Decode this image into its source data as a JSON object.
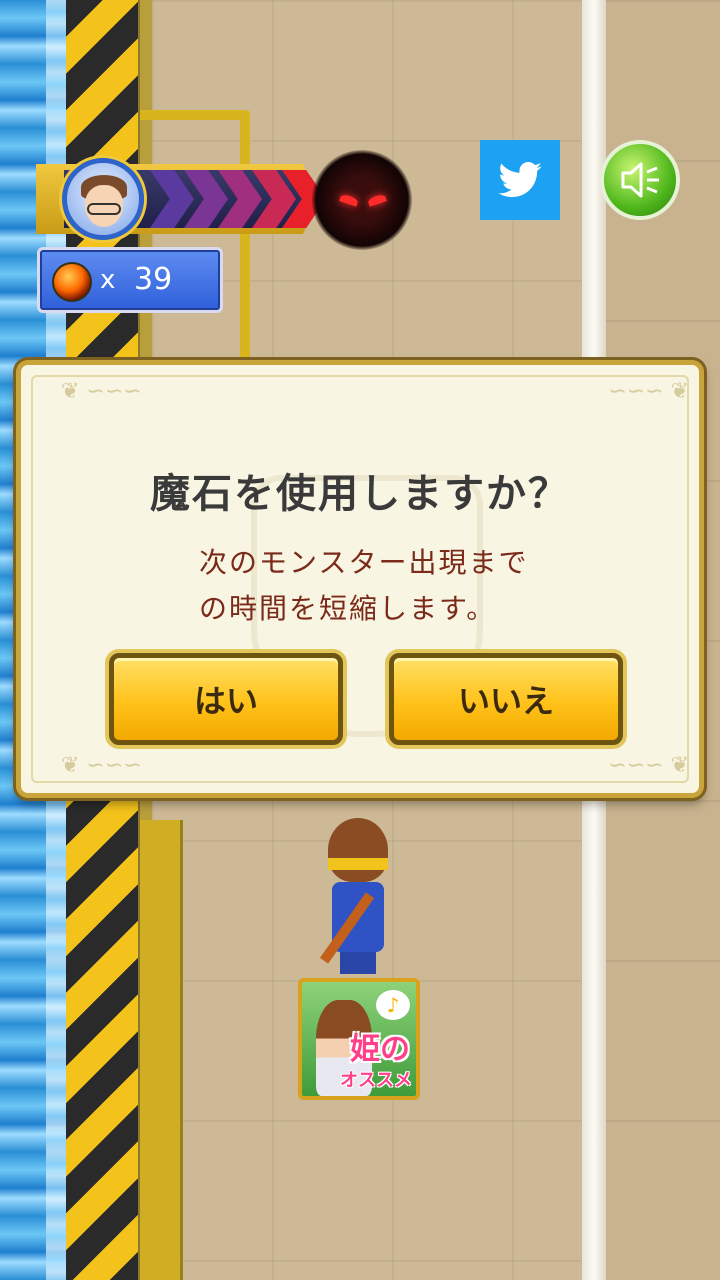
{
  "hud": {
    "gem_count_prefix": "x",
    "gem_count": "39",
    "progress_chevrons": 5
  },
  "icons": {
    "avatar": "player-avatar-icon",
    "monster": "dark-monster-icon",
    "gem": "magic-stone-icon",
    "twitter": "twitter-icon",
    "sound": "speaker-icon"
  },
  "dialog": {
    "title": "魔石を使用しますか？",
    "message_line1": "次のモンスター出現まで",
    "message_line2": "の時間を短縮します。",
    "yes_label": "はい",
    "no_label": "いいえ"
  },
  "ad_banner": {
    "text_main": "姫の",
    "text_sub": "オススメ",
    "note_symbol": "♪"
  },
  "colors": {
    "dialog_bg": "#f8f5e3",
    "dialog_title": "#3a3a3a",
    "dialog_message": "#7b2a1a",
    "button_fill": "#ffc21a",
    "twitter_blue": "#1da1f2",
    "sound_green": "#4fb71c",
    "gem_counter_blue": "#2e5fd9"
  }
}
